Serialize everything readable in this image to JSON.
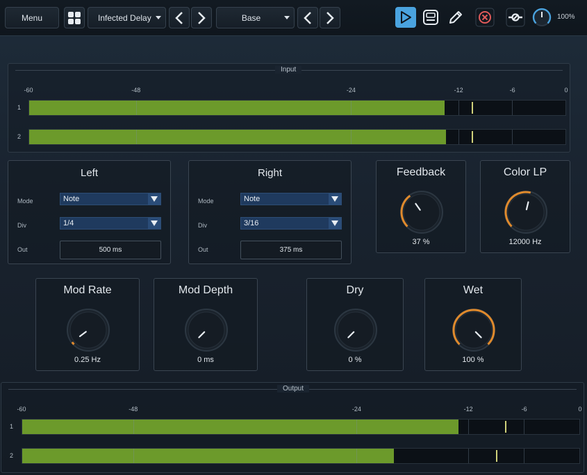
{
  "toolbar": {
    "menu_label": "Menu",
    "preset_name": "Infected Delay",
    "prev_symbol": "‹",
    "next_symbol": "›",
    "bank_name": "Base",
    "zoom": "100%",
    "icons": [
      "grid-icon",
      "play-icon",
      "device-icon",
      "pencil-icon",
      "close-circle-icon",
      "bypass-icon",
      "zoom-knob-icon"
    ],
    "accent_color": "#4aa3df",
    "close_color": "#e05a5a"
  },
  "input_meter": {
    "title": "Input",
    "ticks": [
      "-60",
      "-48",
      "-24",
      "-12",
      "-6",
      "0"
    ],
    "channels": [
      {
        "label": "1",
        "level_db": -13.5,
        "peak_db": -10.5
      },
      {
        "label": "2",
        "level_db": -13.4,
        "peak_db": -10.5
      }
    ]
  },
  "output_meter": {
    "title": "Output",
    "ticks": [
      "-60",
      "-48",
      "-24",
      "-12",
      "-6",
      "0"
    ],
    "channels": [
      {
        "label": "1",
        "level_db": -13.0,
        "peak_db": -8.0
      },
      {
        "label": "2",
        "level_db": -20.0,
        "peak_db": -9.0
      }
    ]
  },
  "left": {
    "title": "Left",
    "mode_label": "Mode",
    "mode_value": "Note",
    "div_label": "Div",
    "div_value": "1/4",
    "out_label": "Out",
    "out_value": "500 ms"
  },
  "right": {
    "title": "Right",
    "mode_label": "Mode",
    "mode_value": "Note",
    "div_label": "Div",
    "div_value": "3/16",
    "out_label": "Out",
    "out_value": "375 ms"
  },
  "knobs": {
    "feedback": {
      "label": "Feedback",
      "value": "37 %",
      "fraction": 0.37
    },
    "color_lp": {
      "label": "Color LP",
      "value": "12000 Hz",
      "fraction": 0.55
    },
    "mod_rate": {
      "label": "Mod Rate",
      "value": "0.25 Hz",
      "fraction": 0.03
    },
    "mod_depth": {
      "label": "Mod Depth",
      "value": "0 ms",
      "fraction": 0.0
    },
    "dry": {
      "label": "Dry",
      "value": "0 %",
      "fraction": 0.0
    },
    "wet": {
      "label": "Wet",
      "value": "100 %",
      "fraction": 1.0
    }
  },
  "colors": {
    "meter_fill": "#6c9a2b",
    "knob_arc": "#e08a2c",
    "select_bg": "#1f3a5e"
  }
}
